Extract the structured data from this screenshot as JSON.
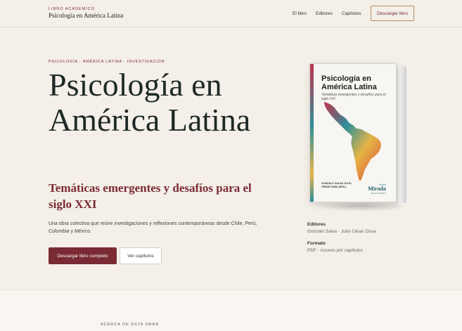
{
  "header": {
    "kicker": "LIBRO ACADÉMICO",
    "title": "Psicología en América Latina",
    "nav": [
      "El libro",
      "Editores",
      "Capítulos"
    ],
    "cta": "Descargar libro"
  },
  "hero": {
    "kicker": "PSICOLOGÍA · AMÉRICA LATINA · INVESTIGACIÓN",
    "title": "Psicología en América Latina",
    "subtitle": "Temáticas emergentes y desafíos para el siglo XXI",
    "description": "Una obra colectiva que reúne investigaciones y reflexiones contemporáneas desde Chile, Perú, Colombia y México.",
    "primary_button": "Descargar libro completo",
    "secondary_button": "Ver capítulos"
  },
  "book": {
    "title": "Psicología en América Latina",
    "subtitle": "Temáticas emergentes y desafíos para el siglo XXI",
    "authors": "GONZALO SALAS JULIO CÉSAR OSSA (EDS.)",
    "publisher_small": "Nueva",
    "publisher_big": "Mirada",
    "publisher_tiny": "EDICIONES"
  },
  "meta": {
    "editors_label": "Editores",
    "editors_value": "Gonzalo Salas · Julio César Ossa",
    "format_label": "Formato",
    "format_value": "PDF · Acceso por capítulos"
  },
  "about": {
    "kicker": "ACERCA DE ESTA OBRA"
  },
  "colors": {
    "accent": "#7a2a34",
    "background": "#f4efe8",
    "title": "#1e2a25"
  }
}
